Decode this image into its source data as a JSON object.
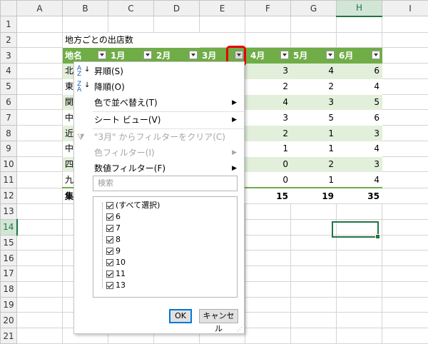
{
  "columns": [
    "A",
    "B",
    "C",
    "D",
    "E",
    "F",
    "G",
    "H",
    "I"
  ],
  "rows": [
    "1",
    "2",
    "3",
    "4",
    "5",
    "6",
    "7",
    "8",
    "9",
    "10",
    "11",
    "12",
    "13",
    "14",
    "15",
    "16",
    "17",
    "18",
    "19",
    "20",
    "21"
  ],
  "sheet_title": "地方ごとの出店数",
  "table_headers": [
    "地名",
    "1月",
    "2月",
    "3月",
    "4月",
    "5月",
    "6月"
  ],
  "row_labels_visible": [
    "北",
    "東",
    "関",
    "中",
    "近",
    "中",
    "四",
    "九",
    "集"
  ],
  "table_rows": [
    {
      "f": "3",
      "g": "4",
      "h": "6"
    },
    {
      "f": "2",
      "g": "2",
      "h": "4"
    },
    {
      "f": "4",
      "g": "3",
      "h": "5"
    },
    {
      "f": "3",
      "g": "5",
      "h": "6"
    },
    {
      "f": "2",
      "g": "1",
      "h": "3"
    },
    {
      "f": "1",
      "g": "1",
      "h": "4"
    },
    {
      "f": "0",
      "g": "2",
      "h": "3"
    },
    {
      "f": "0",
      "g": "1",
      "h": "4"
    }
  ],
  "totals": {
    "f": "15",
    "g": "19",
    "h": "35"
  },
  "menu": {
    "sort_asc": "昇順(S)",
    "sort_desc": "降順(O)",
    "sort_by_color": "色で並べ替え(T)",
    "sheet_view": "シート ビュー(V)",
    "clear_filter": "\"3月\" からフィルターをクリア(C)",
    "color_filter": "色フィルター(I)",
    "number_filter": "数値フィルター(F)",
    "search_placeholder": "検索",
    "checklist": [
      "(すべて選択)",
      "6",
      "7",
      "8",
      "9",
      "10",
      "11",
      "13"
    ],
    "ok": "OK",
    "cancel": "キャンセル"
  },
  "icons": {
    "sort_asc": "sort-ascending-icon",
    "sort_desc": "sort-descending-icon",
    "clear": "clear-filter-icon"
  },
  "colors": {
    "header_green": "#70ad47",
    "band_green": "#e2efda",
    "highlight_red": "#e60000",
    "excel_green": "#217346"
  }
}
